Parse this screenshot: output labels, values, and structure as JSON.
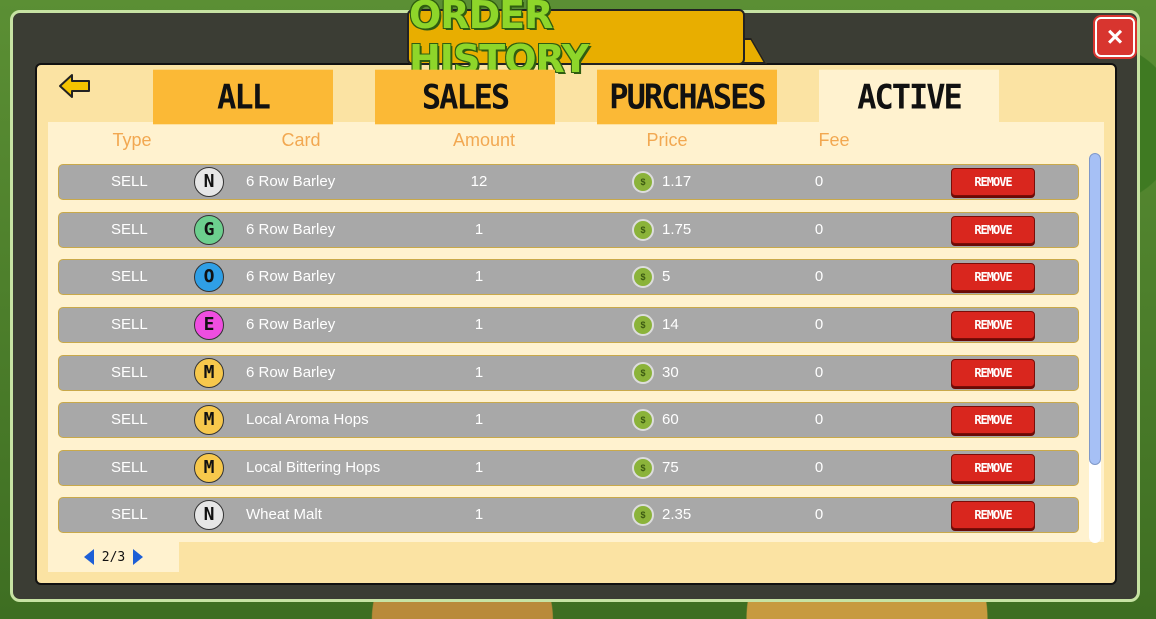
{
  "title": "ORDER HISTORY",
  "close_icon": "×",
  "tabs": [
    {
      "label": "ALL",
      "active": false
    },
    {
      "label": "SALES",
      "active": false
    },
    {
      "label": "PURCHASES",
      "active": false
    },
    {
      "label": "ACTIVE",
      "active": true
    }
  ],
  "columns": {
    "type": "Type",
    "card": "Card",
    "amount": "Amount",
    "price": "Price",
    "fee": "Fee"
  },
  "rows": [
    {
      "type": "SELL",
      "rarity": "N",
      "rarity_color": "#e6e6e6",
      "card": "6 Row Barley",
      "amount": "12",
      "price": "1.17",
      "fee": "0",
      "action": "REMOVE"
    },
    {
      "type": "SELL",
      "rarity": "G",
      "rarity_color": "#6ccf8e",
      "card": "6 Row Barley",
      "amount": "1",
      "price": "1.75",
      "fee": "0",
      "action": "REMOVE"
    },
    {
      "type": "SELL",
      "rarity": "O",
      "rarity_color": "#2f9fe6",
      "card": "6 Row Barley",
      "amount": "1",
      "price": "5",
      "fee": "0",
      "action": "REMOVE"
    },
    {
      "type": "SELL",
      "rarity": "E",
      "rarity_color": "#ef4ee0",
      "card": "6 Row Barley",
      "amount": "1",
      "price": "14",
      "fee": "0",
      "action": "REMOVE"
    },
    {
      "type": "SELL",
      "rarity": "M",
      "rarity_color": "#f7c84c",
      "card": "6 Row Barley",
      "amount": "1",
      "price": "30",
      "fee": "0",
      "action": "REMOVE"
    },
    {
      "type": "SELL",
      "rarity": "M",
      "rarity_color": "#f7c84c",
      "card": "Local Aroma Hops",
      "amount": "1",
      "price": "60",
      "fee": "0",
      "action": "REMOVE"
    },
    {
      "type": "SELL",
      "rarity": "M",
      "rarity_color": "#f7c84c",
      "card": "Local Bittering Hops",
      "amount": "1",
      "price": "75",
      "fee": "0",
      "action": "REMOVE"
    },
    {
      "type": "SELL",
      "rarity": "N",
      "rarity_color": "#e6e6e6",
      "card": "Wheat Malt",
      "amount": "1",
      "price": "2.35",
      "fee": "0",
      "action": "REMOVE"
    }
  ],
  "pagination": {
    "label": "2/3"
  },
  "icons": {
    "back": "back-arrow-icon",
    "close": "close-icon",
    "coin": "currency-coin-icon",
    "prev": "prev-page-icon",
    "next": "next-page-icon"
  }
}
